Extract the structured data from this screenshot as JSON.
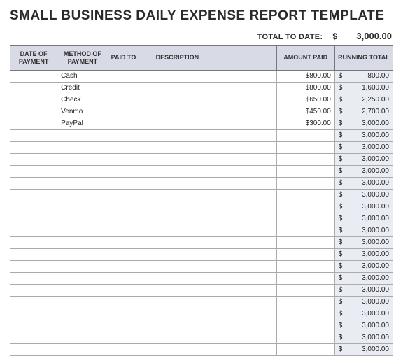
{
  "title": "SMALL BUSINESS DAILY EXPENSE REPORT TEMPLATE",
  "total": {
    "label": "TOTAL TO DATE:",
    "currency": "$",
    "value": "3,000.00"
  },
  "columns": {
    "date": "DATE OF PAYMENT",
    "method": "METHOD OF PAYMENT",
    "paid_to": "PAID TO",
    "description": "DESCRIPTION",
    "amount": "AMOUNT PAID",
    "running": "RUNNING TOTAL"
  },
  "currency_symbol": "$",
  "rows": [
    {
      "date": "",
      "method": "Cash",
      "paid_to": "",
      "description": "",
      "amount": "$800.00",
      "running": "800.00"
    },
    {
      "date": "",
      "method": "Credit",
      "paid_to": "",
      "description": "",
      "amount": "$800.00",
      "running": "1,600.00"
    },
    {
      "date": "",
      "method": "Check",
      "paid_to": "",
      "description": "",
      "amount": "$650.00",
      "running": "2,250.00"
    },
    {
      "date": "",
      "method": "Venmo",
      "paid_to": "",
      "description": "",
      "amount": "$450.00",
      "running": "2,700.00"
    },
    {
      "date": "",
      "method": "PayPal",
      "paid_to": "",
      "description": "",
      "amount": "$300.00",
      "running": "3,000.00"
    },
    {
      "date": "",
      "method": "",
      "paid_to": "",
      "description": "",
      "amount": "",
      "running": "3,000.00"
    },
    {
      "date": "",
      "method": "",
      "paid_to": "",
      "description": "",
      "amount": "",
      "running": "3,000.00"
    },
    {
      "date": "",
      "method": "",
      "paid_to": "",
      "description": "",
      "amount": "",
      "running": "3,000.00"
    },
    {
      "date": "",
      "method": "",
      "paid_to": "",
      "description": "",
      "amount": "",
      "running": "3,000.00"
    },
    {
      "date": "",
      "method": "",
      "paid_to": "",
      "description": "",
      "amount": "",
      "running": "3,000.00"
    },
    {
      "date": "",
      "method": "",
      "paid_to": "",
      "description": "",
      "amount": "",
      "running": "3,000.00"
    },
    {
      "date": "",
      "method": "",
      "paid_to": "",
      "description": "",
      "amount": "",
      "running": "3,000.00"
    },
    {
      "date": "",
      "method": "",
      "paid_to": "",
      "description": "",
      "amount": "",
      "running": "3,000.00"
    },
    {
      "date": "",
      "method": "",
      "paid_to": "",
      "description": "",
      "amount": "",
      "running": "3,000.00"
    },
    {
      "date": "",
      "method": "",
      "paid_to": "",
      "description": "",
      "amount": "",
      "running": "3,000.00"
    },
    {
      "date": "",
      "method": "",
      "paid_to": "",
      "description": "",
      "amount": "",
      "running": "3,000.00"
    },
    {
      "date": "",
      "method": "",
      "paid_to": "",
      "description": "",
      "amount": "",
      "running": "3,000.00"
    },
    {
      "date": "",
      "method": "",
      "paid_to": "",
      "description": "",
      "amount": "",
      "running": "3,000.00"
    },
    {
      "date": "",
      "method": "",
      "paid_to": "",
      "description": "",
      "amount": "",
      "running": "3,000.00"
    },
    {
      "date": "",
      "method": "",
      "paid_to": "",
      "description": "",
      "amount": "",
      "running": "3,000.00"
    },
    {
      "date": "",
      "method": "",
      "paid_to": "",
      "description": "",
      "amount": "",
      "running": "3,000.00"
    },
    {
      "date": "",
      "method": "",
      "paid_to": "",
      "description": "",
      "amount": "",
      "running": "3,000.00"
    },
    {
      "date": "",
      "method": "",
      "paid_to": "",
      "description": "",
      "amount": "",
      "running": "3,000.00"
    },
    {
      "date": "",
      "method": "",
      "paid_to": "",
      "description": "",
      "amount": "",
      "running": "3,000.00"
    }
  ]
}
